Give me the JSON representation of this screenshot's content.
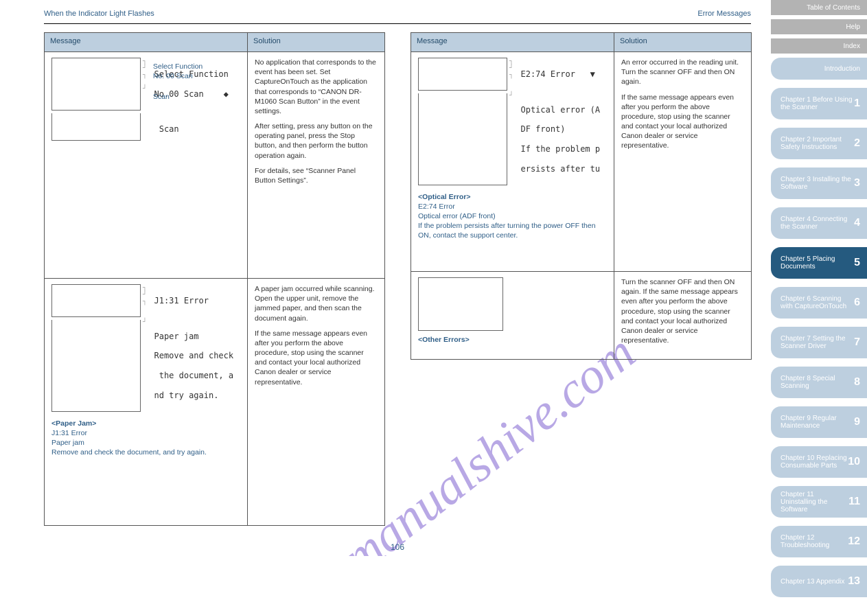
{
  "header": {
    "left": "When the Indicator Light Flashes",
    "right": "Error Messages"
  },
  "table1": {
    "head_msg": "Message",
    "head_sol": "Solution",
    "r1": {
      "lcd_top1": "Select Function",
      "lcd_top2": "No.00 Scan    ◆",
      "lcd_bot": " Scan",
      "msg_l1": "Select Function",
      "msg_l2": "No. 00 Scan",
      "msg_l3": "Scan",
      "sol": "No application that corresponds to the event has been set. Set CaptureOnTouch as the application that corresponds to “CANON DR-M1060 Scan Button” in the event settings.",
      "sol_after": "After setting, press any button on the operating panel, press the Stop button, and then perform the button operation again.",
      "sol_ref": "For details, see “Scanner Panel Button Settings”."
    },
    "r2": {
      "lcd_top": "J1:31 Error",
      "lcd_l1": "Paper jam",
      "lcd_l2": "Remove and check",
      "lcd_l3": " the document, a",
      "lcd_l4": "nd try again.",
      "cat": "<Paper Jam>",
      "msg_l1": "J1:31 Error",
      "msg_l2": "Paper jam",
      "msg_l3": "Remove and check the document, and try again.",
      "sol_p1": "A paper jam occurred while scanning. Open the upper unit, remove the jammed paper, and then scan the document again.",
      "sol_p2": "If the same message appears even after you perform the above procedure, stop using the scanner and contact your local authorized Canon dealer or service representative."
    }
  },
  "table2": {
    "head_msg": "Message",
    "head_sol": "Solution",
    "r1": {
      "lcd_top": "E2:74 Error   ▼",
      "lcd_l1": "Optical error (A",
      "lcd_l2": "DF front)",
      "lcd_l3": "If the problem p",
      "lcd_l4": "ersists after tu",
      "cat": "<Optical Error>",
      "msg_l1": "E2:74 Error",
      "msg_l2": "Optical error (ADF front)",
      "msg_l3": "If the problem persists after turning the power OFF then ON, contact the support center.",
      "sol_p1": "An error occurred in the reading unit. Turn the scanner OFF and then ON again.",
      "sol_p2": "If the same message appears even after you perform the above procedure, stop using the scanner and contact your local authorized Canon dealer or service representative."
    },
    "r2": {
      "cat": "<Other Errors>",
      "sol": "Turn the scanner OFF and then ON again. If the same message appears even after you perform the above procedure, stop using the scanner and contact your local authorized Canon dealer or service representative."
    }
  },
  "sidetabs": {
    "g1": "Table of Contents",
    "g2": "Help",
    "g3": "Index",
    "t1": "Introduction",
    "t2": "Chapter 1 Before Using the Scanner",
    "t3": "Chapter 2 Important Safety Instructions",
    "t4": "Chapter 3 Installing the Software",
    "t5": "Chapter 4 Connecting the Scanner",
    "t6": "Chapter 5 Placing Documents",
    "t7": "Chapter 6 Scanning with CaptureOnTouch",
    "t8": "Chapter 7 Setting the Scanner Driver",
    "t9": "Chapter 8 Special Scanning",
    "t10": "Chapter 9 Regular Maintenance",
    "t11": "Chapter 10 Replacing Consumable Parts",
    "t12": "Chapter 11 Uninstalling the Software",
    "t13": "Chapter 12 Troubleshooting",
    "t14": "Chapter 13 Appendix",
    "n_active": "12"
  },
  "watermark": "manualshive.com",
  "pagenum": "106"
}
